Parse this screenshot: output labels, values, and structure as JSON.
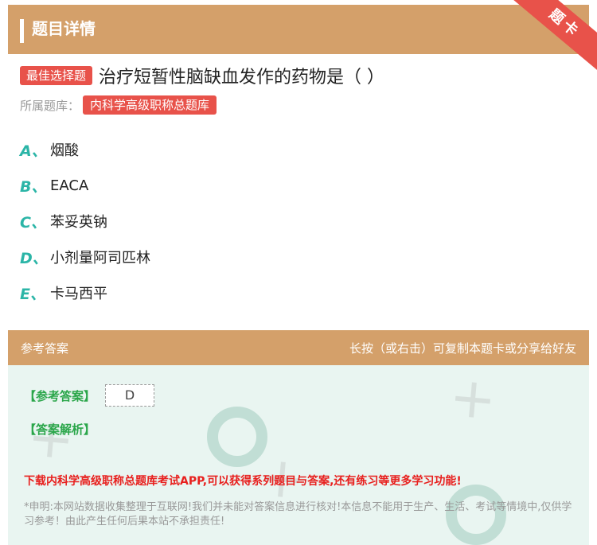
{
  "header": {
    "title": "题目详情",
    "ribbon": "题卡"
  },
  "question": {
    "type_tag": "最佳选择题",
    "text": "治疗短暂性脑缺血发作的药物是（ ）",
    "bank_label": "所属题库：",
    "bank_name": "内科学高级职称总题库"
  },
  "options": [
    {
      "letter": "A、",
      "text": "烟酸"
    },
    {
      "letter": "B、",
      "text": "EACA"
    },
    {
      "letter": "C、",
      "text": "苯妥英钠"
    },
    {
      "letter": "D、",
      "text": "小剂量阿司匹林"
    },
    {
      "letter": "E、",
      "text": "卡马西平"
    }
  ],
  "answer_section": {
    "title": "参考答案",
    "hint": "长按（或右击）可复制本题卡或分享给好友",
    "answer_label": "【参考答案】",
    "answer_value": "D",
    "explanation_label": "【答案解析】",
    "promo": "下载内科学高级职称总题库考试APP,可以获得系列题目与答案,还有练习等更多学习功能!",
    "disclaimer": "*申明:本网站数据收集整理于互联网!我们并未能对答案信息进行核对!本信息不能用于生产、生活、考试等情境中,仅供学习参考！由此产生任何后果本站不承担责任!"
  },
  "colors": {
    "header": "#d4a06a",
    "accent_red": "#e8524a",
    "option_letter": "#2bb5a7",
    "answer_green": "#2aa64a",
    "promo_red": "#e8201e"
  }
}
